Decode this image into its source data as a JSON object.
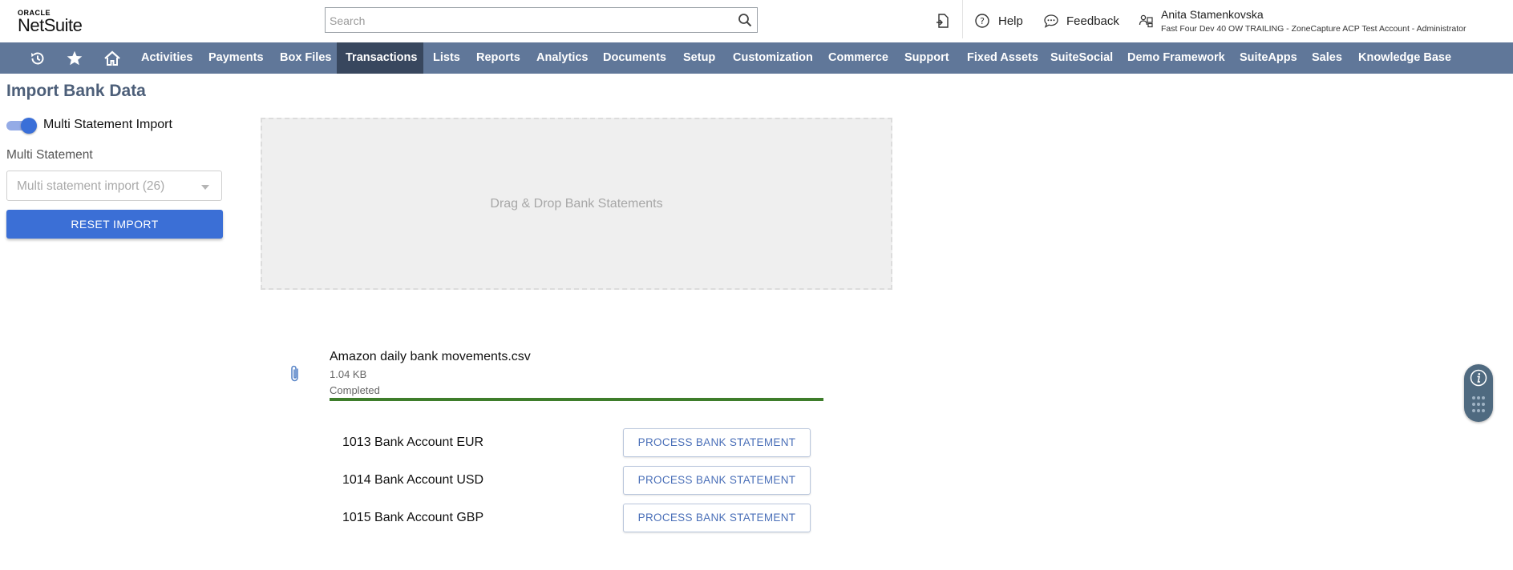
{
  "header": {
    "logo_top": "ORACLE",
    "logo_main": "NetSuite",
    "search_placeholder": "Search",
    "help_label": "Help",
    "feedback_label": "Feedback",
    "user_name": "Anita Stamenkovska",
    "user_context": "Fast Four Dev 40 OW TRAILING - ZoneCapture ACP Test Account - Administrator"
  },
  "nav": {
    "items": [
      "Activities",
      "Payments",
      "Box Files",
      "Transactions",
      "Lists",
      "Reports",
      "Analytics",
      "Documents",
      "Setup",
      "Customization",
      "Commerce",
      "Support",
      "Fixed Assets",
      "SuiteSocial",
      "Demo Framework",
      "SuiteApps",
      "Sales",
      "Knowledge Base"
    ],
    "active": "Transactions"
  },
  "page": {
    "title": "Import Bank Data",
    "toggle_label": "Multi Statement Import",
    "toggle_on": true,
    "multi_statement_label": "Multi Statement",
    "multi_statement_select": "Multi statement import (26)",
    "reset_button": "RESET IMPORT",
    "dropzone_text": "Drag & Drop Bank Statements"
  },
  "file": {
    "name": "Amazon daily bank movements.csv",
    "size": "1.04 KB",
    "status": "Completed",
    "progress": 1.0
  },
  "accounts": [
    {
      "name": "1013 Bank Account EUR",
      "button": "PROCESS BANK STATEMENT"
    },
    {
      "name": "1014 Bank Account USD",
      "button": "PROCESS BANK STATEMENT"
    },
    {
      "name": "1015 Bank Account GBP",
      "button": "PROCESS BANK STATEMENT"
    }
  ],
  "colors": {
    "nav_bg": "#607799",
    "nav_active": "#38475e",
    "primary": "#3b6fd6",
    "progress": "#3e7d2b",
    "title": "#4d5f79"
  }
}
